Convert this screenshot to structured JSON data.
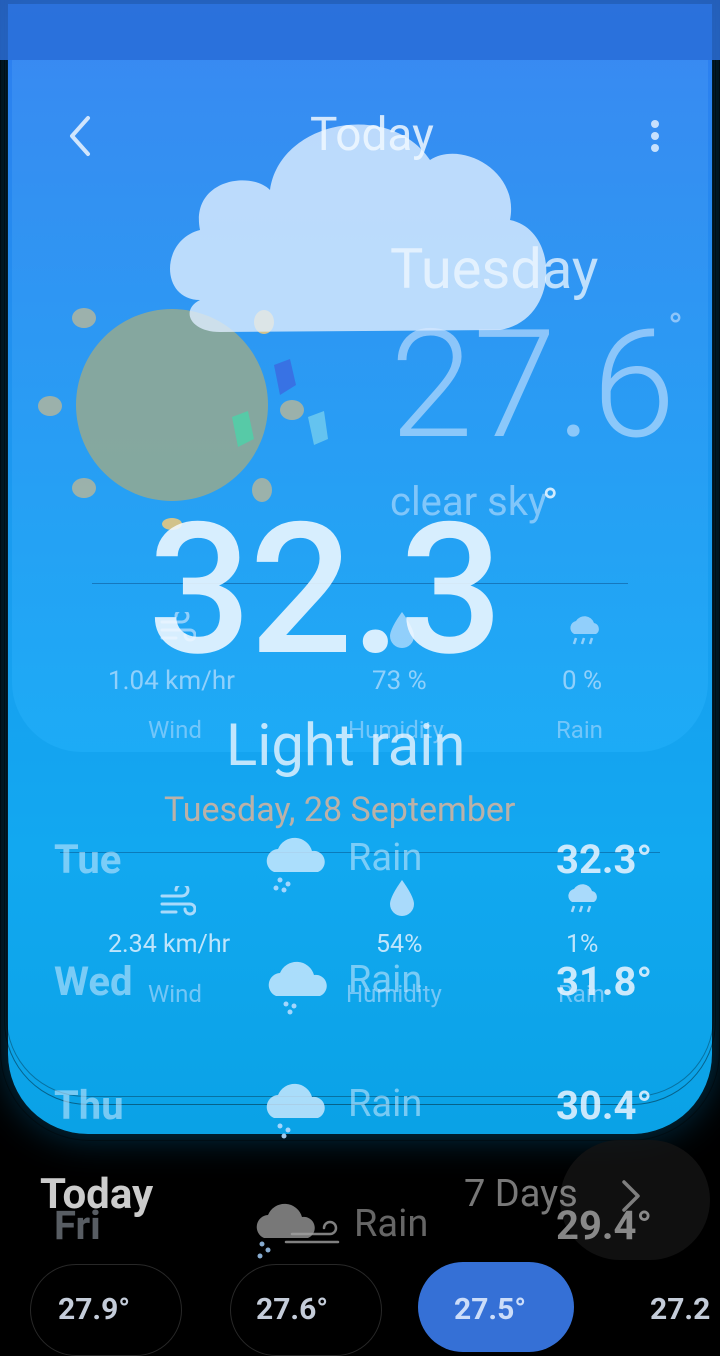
{
  "header": {
    "title": "Today",
    "back_icon": "chevron-left-icon",
    "menu_icon": "more-vert-icon"
  },
  "overlay_current": {
    "day": "Tuesday",
    "temperature": "27.6",
    "degree": "°",
    "condition": "clear sky",
    "wind": "1.04 km/hr",
    "wind_label": "Wind",
    "humidity": "73 %",
    "humidity_label": "Humidity",
    "rain": "0 %",
    "rain_label": "Rain"
  },
  "current": {
    "temperature": "32.3",
    "degree": "°",
    "condition": "Light rain",
    "date": "Tuesday, 28 September",
    "wind": "2.34 km/hr",
    "wind_label": "Wind",
    "humidity": "54%",
    "humidity_label": "Humidity",
    "rain": "1%",
    "rain_label": "Rain"
  },
  "forecast": [
    {
      "day": "Tue",
      "condition": "Rain",
      "temp": "32.3°",
      "icon": "rain-cloud-icon"
    },
    {
      "day": "Wed",
      "condition": "Rain",
      "temp": "31.8°",
      "icon": "rain-cloud-icon"
    },
    {
      "day": "Thu",
      "condition": "Rain",
      "temp": "30.4°",
      "icon": "rain-cloud-icon"
    },
    {
      "day": "Fri",
      "condition": "Rain",
      "temp": "29.4°",
      "icon": "rain-wind-cloud-icon"
    }
  ],
  "bottom": {
    "today_label": "Today",
    "seven_days_label": "7 Days",
    "hourly_temps": [
      "27.9°",
      "27.6°",
      "27.5°",
      "27.2"
    ]
  },
  "colors": {
    "card_top": "#2e7df0",
    "card_bottom": "#12a8f0",
    "background": "#000000"
  }
}
